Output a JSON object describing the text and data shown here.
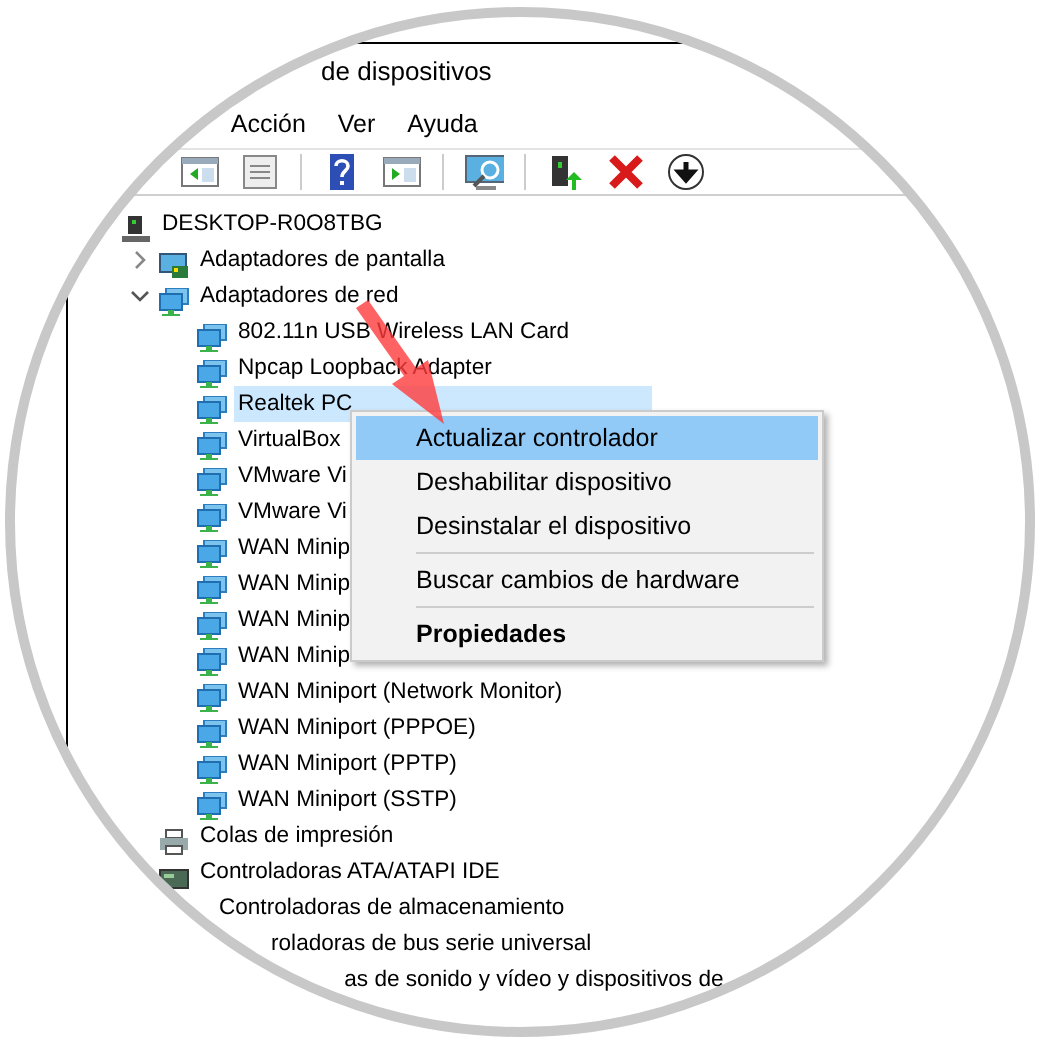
{
  "window": {
    "title": "de dispositivos"
  },
  "menu": [
    "Acción",
    "Ver",
    "Ayuda"
  ],
  "tree": {
    "label": "DESKTOP-R0O8TBG",
    "kind": "computer",
    "children": [
      {
        "label": "Adaptadores de pantalla",
        "kind": "display",
        "expanded": false
      },
      {
        "label": "Adaptadores de red",
        "kind": "network",
        "expanded": true,
        "children": [
          {
            "label": "802.11n USB Wireless LAN Card",
            "kind": "network",
            "selected": false
          },
          {
            "label": "Npcap Loopback Adapter",
            "kind": "network",
            "selected": false
          },
          {
            "label": "Realtek PC",
            "kind": "network",
            "selected": true
          },
          {
            "label": "VirtualBox",
            "kind": "network",
            "selected": false
          },
          {
            "label": "VMware Vi",
            "kind": "network",
            "selected": false
          },
          {
            "label": "VMware Vi",
            "kind": "network",
            "selected": false
          },
          {
            "label": "WAN Minip",
            "kind": "network",
            "selected": false
          },
          {
            "label": "WAN Minip",
            "kind": "network",
            "selected": false
          },
          {
            "label": "WAN Minip",
            "kind": "network",
            "selected": false
          },
          {
            "label": "WAN Minip",
            "kind": "network",
            "selected": false
          },
          {
            "label": "WAN Miniport (Network Monitor)",
            "kind": "network",
            "selected": false
          },
          {
            "label": "WAN Miniport (PPPOE)",
            "kind": "network",
            "selected": false
          },
          {
            "label": "WAN Miniport (PPTP)",
            "kind": "network",
            "selected": false
          },
          {
            "label": "WAN Miniport (SSTP)",
            "kind": "network",
            "selected": false
          }
        ]
      },
      {
        "label": "Colas de impresión",
        "kind": "printer"
      },
      {
        "label": "Controladoras ATA/ATAPI IDE",
        "kind": "drive"
      },
      {
        "label": "Controladoras de almacenamiento"
      },
      {
        "label": "roladoras de bus serie universal"
      },
      {
        "label": "as de sonido y vídeo y dispositivos de"
      }
    ]
  },
  "context_menu": [
    {
      "label": "Actualizar controlador",
      "highlighted": true
    },
    {
      "label": "Deshabilitar dispositivo",
      "highlighted": false
    },
    {
      "label": "Desinstalar el dispositivo",
      "highlighted": false
    },
    {
      "label": "Buscar cambios de hardware",
      "highlighted": false,
      "separator_before": true
    },
    {
      "label": "Propiedades",
      "highlighted": false,
      "separator_before": true,
      "default": true
    }
  ]
}
